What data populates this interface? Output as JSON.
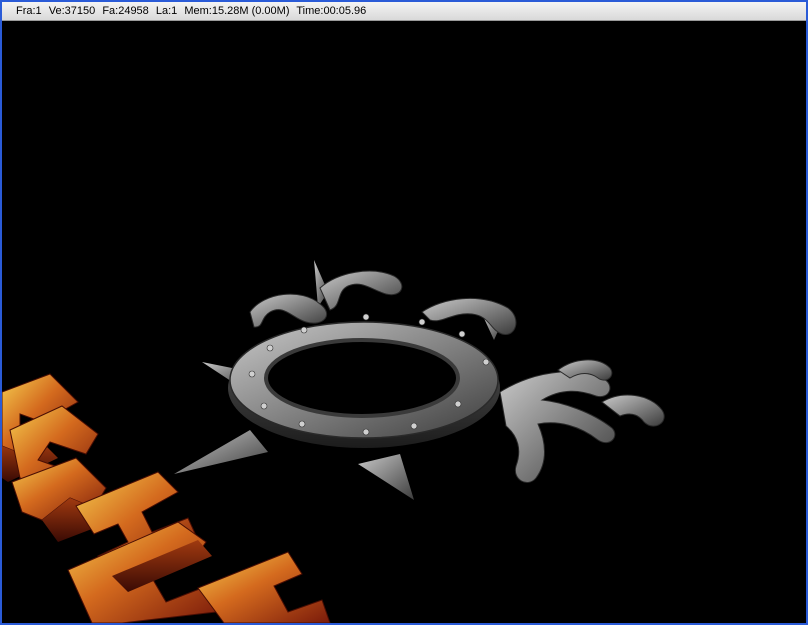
{
  "status": {
    "frame": "Fra:1",
    "vertices": "Ve:37150",
    "faces": "Fa:24958",
    "layer": "La:1",
    "memory": "Mem:15.28M (0.00M)",
    "time": "Time:00:05.96"
  },
  "render": {
    "background": "#000000",
    "metal_light": "#b8b8b8",
    "metal_mid": "#7d7d7d",
    "metal_dark": "#3a3a3a",
    "fire_light": "#f0c040",
    "fire_mid": "#c8601c",
    "fire_dark": "#6a1408"
  }
}
